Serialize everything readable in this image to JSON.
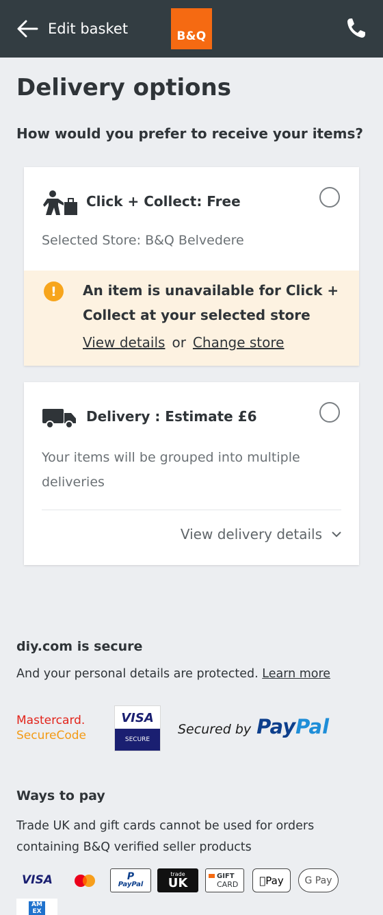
{
  "header": {
    "back_label": "Edit basket",
    "logo_text": "B&Q",
    "back_icon": "arrow-left-icon",
    "phone_icon": "phone-icon"
  },
  "page": {
    "title": "Delivery options",
    "question": "How would you prefer to receive your items?"
  },
  "click_collect": {
    "icon": "person-carrying-box-icon",
    "title": "Click + Collect: Free",
    "store_text": "Selected Store: B&Q Belvedere",
    "selected": false,
    "warning": {
      "icon": "exclamation-icon",
      "text": "An item is unavailable for Click + Collect at your selected store",
      "view_details": "View details",
      "or": "or",
      "change_store": "Change store"
    }
  },
  "delivery": {
    "icon": "truck-icon",
    "title": "Delivery : Estimate £6",
    "description": "Your items will be grouped into multiple deliveries",
    "view_details": "View delivery details",
    "selected": false
  },
  "security": {
    "title": "diy.com is secure",
    "text": "And your personal details are protected.",
    "learn_more": "Learn more",
    "mastercard_line1": "Mastercard.",
    "mastercard_line2": "SecureCode",
    "visa_top": "VISA",
    "visa_bottom": "SECURE",
    "paypal_by": "Secured by",
    "paypal_pay": "Pay",
    "paypal_pal": "Pal"
  },
  "ways_to_pay": {
    "title": "Ways to pay",
    "text": "Trade UK and gift cards cannot be used for orders containing B&Q verified seller products",
    "visa": "VISA",
    "paypal_p": "P",
    "paypal": "PayPal",
    "trade_small": "trade",
    "trade_big": "UK",
    "gift_1": "GIFT",
    "gift_2": "CARD",
    "apple_pay": "Pay",
    "google_pay": "G Pay",
    "amex": "AM EX"
  },
  "colors": {
    "header_bg": "#333d42",
    "brand_orange": "#f56a12",
    "warning_bg": "#fdf2e1",
    "warning_icon": "#f7a51c"
  }
}
